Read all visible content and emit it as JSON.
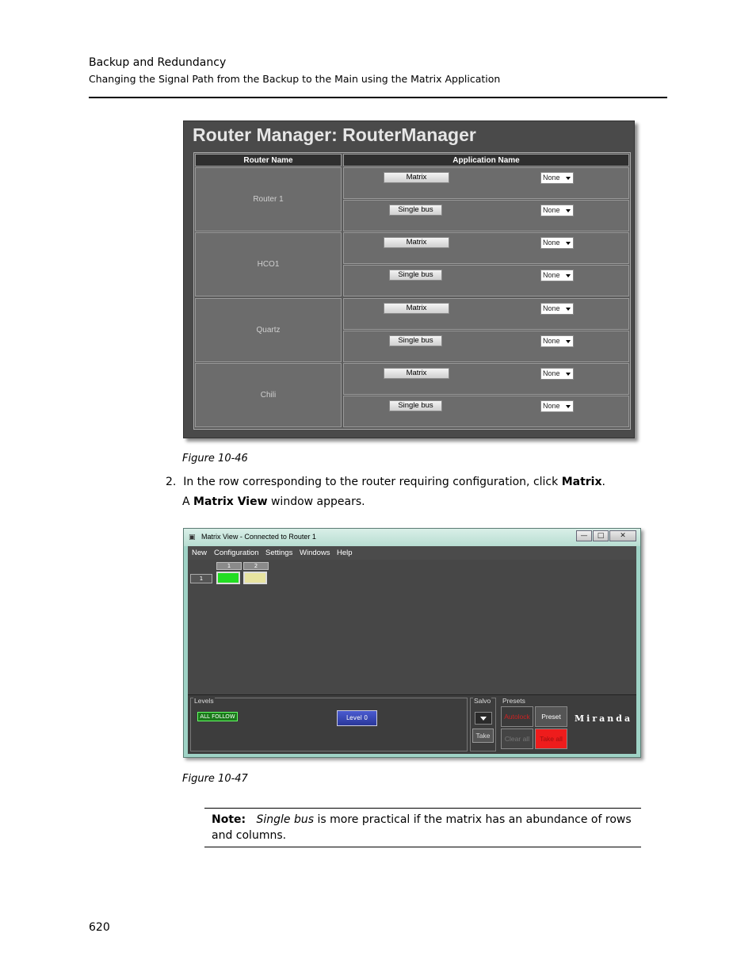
{
  "header": {
    "title": "Backup and Redundancy",
    "subtitle": "Changing the Signal Path from the Backup to the Main using the Matrix Application"
  },
  "router_manager": {
    "title": "Router Manager: RouterManager",
    "col_router": "Router Name",
    "col_app": "Application Name",
    "routers": [
      {
        "name": "Router 1",
        "apps": [
          {
            "button": "Matrix",
            "select": "None"
          },
          {
            "button": "Single bus",
            "select": "None"
          }
        ]
      },
      {
        "name": "HCO1",
        "apps": [
          {
            "button": "Matrix",
            "select": "None"
          },
          {
            "button": "Single bus",
            "select": "None"
          }
        ]
      },
      {
        "name": "Quartz",
        "apps": [
          {
            "button": "Matrix",
            "select": "None"
          },
          {
            "button": "Single bus",
            "select": "None"
          }
        ]
      },
      {
        "name": "Chili",
        "apps": [
          {
            "button": "Matrix",
            "select": "None"
          },
          {
            "button": "Single bus",
            "select": "None"
          }
        ]
      }
    ]
  },
  "caption1": "Figure 10-46",
  "step": {
    "number": "2.",
    "text_before": "In the row corresponding to the router requiring configuration, click ",
    "bold": "Matrix",
    "text_after": ".",
    "line2_before": "A ",
    "line2_bold": "Matrix View",
    "line2_after": " window appears."
  },
  "matrix_view": {
    "window_title": "Matrix View - Connected to Router 1",
    "controls": {
      "minimize": "—",
      "maximize": "□",
      "close": "✕"
    },
    "menu": [
      "New",
      "Configuration",
      "Settings",
      "Windows",
      "Help"
    ],
    "columns": [
      "1",
      "2"
    ],
    "row": "1",
    "cell_colors": [
      "#22dd22",
      "#e8e4a0"
    ],
    "levels_label": "Levels",
    "all_follow": "ALL FOLLOW",
    "level_button": "Level 0",
    "salvo_label": "Salvo",
    "take": "Take",
    "presets_label": "Presets",
    "autolock": "Autolock",
    "preset": "Preset",
    "clear_all": "Clear all",
    "take_all": "Take all",
    "logo": "Miranda"
  },
  "caption2": "Figure 10-47",
  "note": {
    "label": "Note:",
    "italic": "Single bus",
    "text": " is more practical if the matrix has an abundance of rows and columns."
  },
  "page_number": "620"
}
